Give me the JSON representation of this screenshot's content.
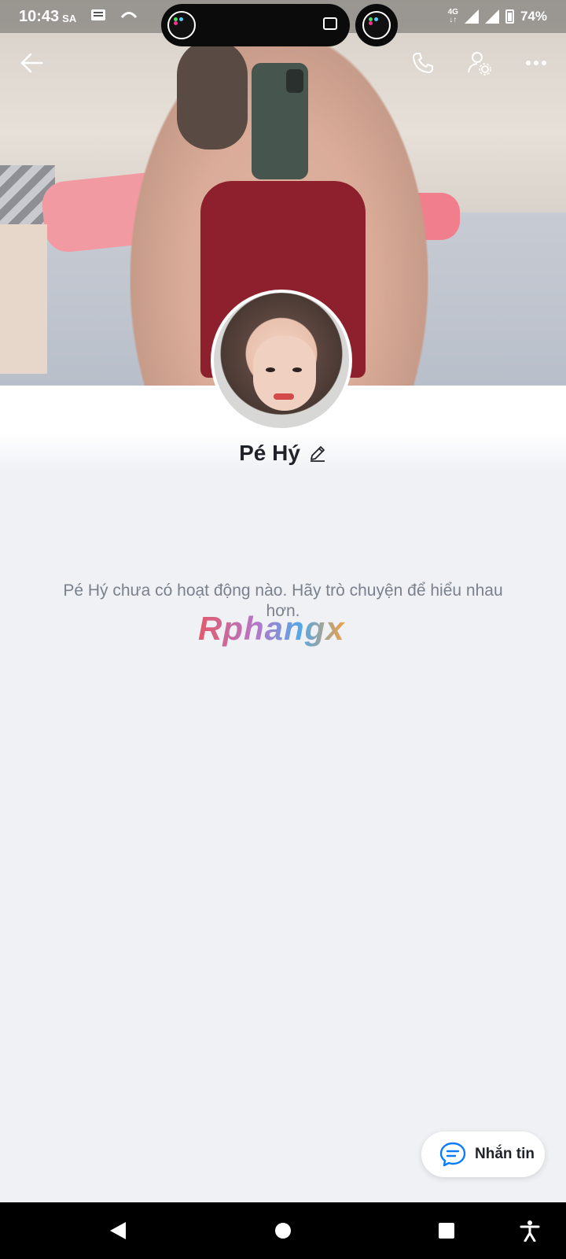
{
  "status_bar": {
    "time": "10:43",
    "ampm": "SA",
    "network": "4G",
    "battery": "74%"
  },
  "profile": {
    "name": "Pé Hý",
    "empty_state": "Pé Hý chưa có hoạt động nào. Hãy trò chuyện để hiểu nhau hơn."
  },
  "watermark": "Rphangx",
  "fab": {
    "label": "Nhắn tin"
  },
  "icons": {
    "back": "arrow-left-icon",
    "call": "phone-icon",
    "settings": "person-settings-icon",
    "more": "more-dots-icon",
    "edit": "pencil-icon",
    "message": "chat-bubble-icon"
  },
  "colors": {
    "accent": "#0a7cff",
    "background": "#eff1f5",
    "text_primary": "#1f2329",
    "text_secondary": "#7a818c"
  }
}
